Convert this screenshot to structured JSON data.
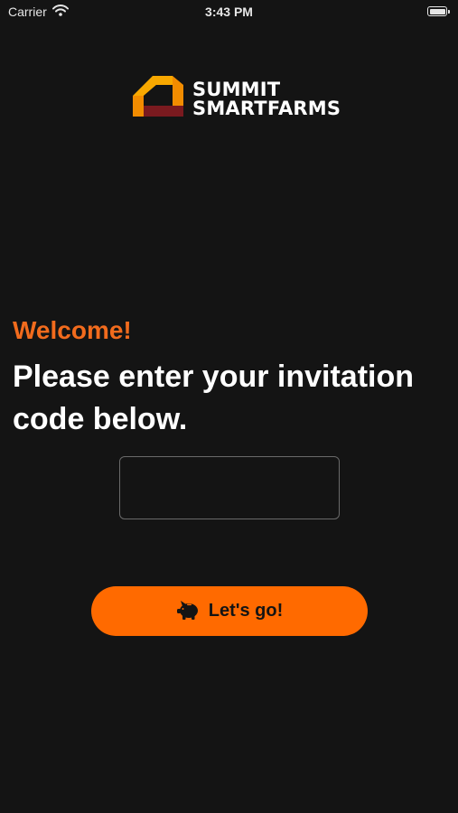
{
  "status_bar": {
    "carrier": "Carrier",
    "time": "3:43 PM"
  },
  "brand": {
    "line1": "SUMMIT",
    "line2": "SMARTFARMS",
    "colors": {
      "orange": "#f28c00",
      "maroon": "#7a1a1f"
    }
  },
  "main": {
    "welcome": "Welcome!",
    "prompt": "Please enter your invitation code below.",
    "invitation_input": {
      "value": "",
      "placeholder": ""
    },
    "go_button": {
      "label": "Let's go!",
      "icon": "piggy-bank-icon"
    }
  },
  "colors": {
    "background": "#141414",
    "accent": "#ff6a00",
    "welcome_text": "#f26b1d"
  }
}
